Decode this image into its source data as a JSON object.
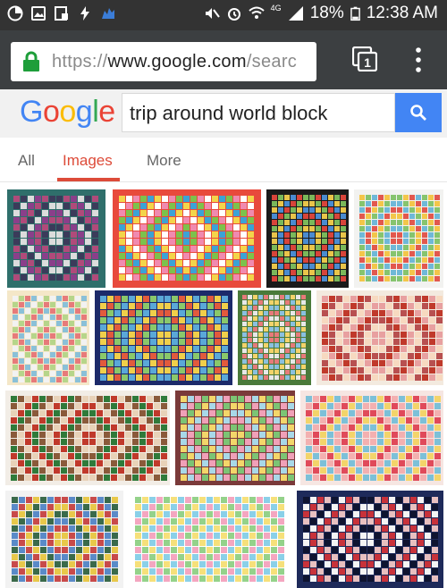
{
  "status_bar": {
    "battery": "18%",
    "time": "12:38 AM",
    "network": "4G"
  },
  "browser": {
    "url_scheme": "https://",
    "url_host": "www.google.com",
    "url_path": "/searc",
    "tab_count": "1"
  },
  "google": {
    "logo_letters": [
      "G",
      "o",
      "o",
      "g",
      "l",
      "e"
    ],
    "logo_colors": [
      "#4285f4",
      "#ea4335",
      "#fbbc05",
      "#4285f4",
      "#34a853",
      "#ea4335"
    ],
    "query": "trip around world block"
  },
  "tabs": {
    "all": "All",
    "images": "Images",
    "more": "More",
    "active_color": "#dd4b39"
  },
  "results": [
    {
      "id": "r1",
      "icon": "quilt-diamond-teal-purple"
    },
    {
      "id": "r2",
      "icon": "quilt-bright-scrappy"
    },
    {
      "id": "r3",
      "icon": "quilt-black-border"
    },
    {
      "id": "r4",
      "icon": "quilt-star-pastel"
    },
    {
      "id": "r5",
      "icon": "quilt-folded-pastel"
    },
    {
      "id": "r6",
      "icon": "quilt-dark-blue-border"
    },
    {
      "id": "r7",
      "icon": "quilt-green-bg"
    },
    {
      "id": "r8",
      "icon": "quilt-red-cream"
    },
    {
      "id": "r9",
      "icon": "quilt-angled-red-green"
    },
    {
      "id": "r10",
      "icon": "quilt-pastel-angled"
    },
    {
      "id": "r11",
      "icon": "quilt-red-pink-diamond"
    },
    {
      "id": "r12",
      "icon": "quilt-hanging-multicolor"
    },
    {
      "id": "r13",
      "icon": "quilt-on-floor-pastel"
    },
    {
      "id": "r14",
      "icon": "quilt-navy-red-white"
    }
  ]
}
